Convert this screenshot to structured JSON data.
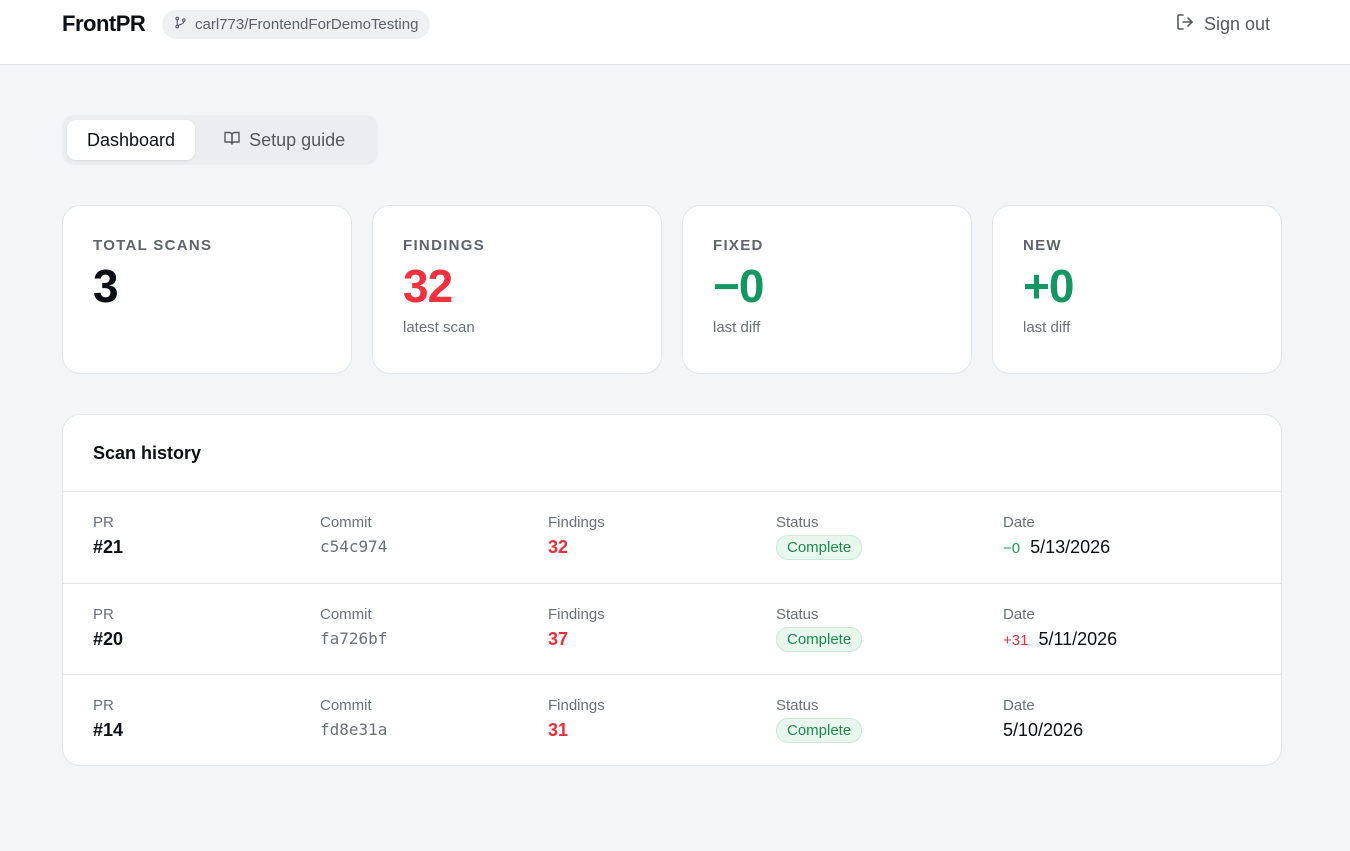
{
  "header": {
    "brand": "FrontPR",
    "repo": "carl773/FrontendForDemoTesting",
    "signout_label": "Sign out"
  },
  "tabs": [
    {
      "label": "Dashboard",
      "active": true
    },
    {
      "label": "Setup guide",
      "active": false
    }
  ],
  "stats": {
    "total_scans": {
      "label": "TOTAL SCANS",
      "value": "3",
      "sub": ""
    },
    "findings": {
      "label": "FINDINGS",
      "value": "32",
      "sub": "latest scan",
      "color": "#f0313e"
    },
    "fixed": {
      "label": "FIXED",
      "value": "−0",
      "sub": "last diff",
      "color": "#129662"
    },
    "new": {
      "label": "NEW",
      "value": "+0",
      "sub": "last diff",
      "color": "#129662"
    }
  },
  "history": {
    "title": "Scan history",
    "columns": {
      "pr": "PR",
      "commit": "Commit",
      "findings": "Findings",
      "status": "Status",
      "date": "Date"
    },
    "rows": [
      {
        "pr": "#21",
        "commit": "c54c974",
        "findings": "32",
        "status": "Complete",
        "delta": "−0",
        "date": "5/13/2026"
      },
      {
        "pr": "#20",
        "commit": "fa726bf",
        "findings": "37",
        "status": "Complete",
        "delta": "+31",
        "date": "5/11/2026"
      },
      {
        "pr": "#14",
        "commit": "fd8e31a",
        "findings": "31",
        "status": "Complete",
        "delta": "",
        "date": "5/10/2026"
      }
    ]
  }
}
